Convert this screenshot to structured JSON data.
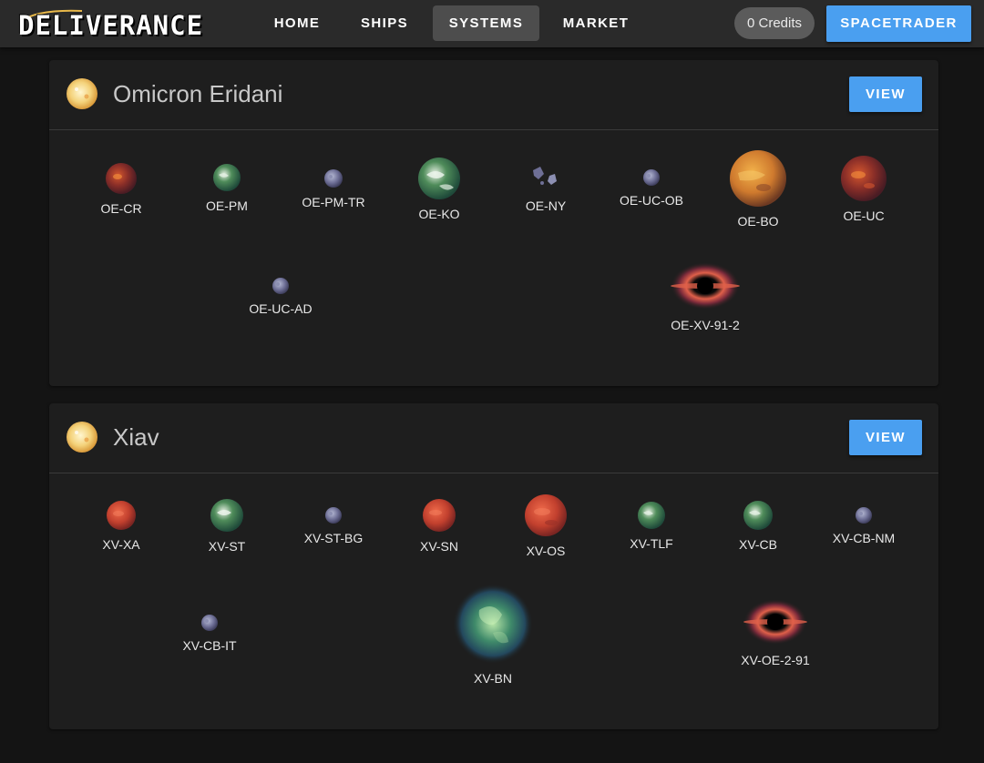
{
  "app": {
    "logo_text": "DELIVERANCE",
    "nav": [
      "HOME",
      "SHIPS",
      "SYSTEMS",
      "MARKET"
    ],
    "active_nav": "SYSTEMS",
    "credits": "0 Credits",
    "account_button": "SPACETRADER"
  },
  "colors": {
    "accent": "#4a9ff0",
    "card_bg": "#1e1e1e",
    "nav_bg": "#2a2a2a"
  },
  "systems": [
    {
      "name": "Omicron Eridani",
      "view_label": "VIEW",
      "icon": "star-icon",
      "bodies": [
        {
          "label": "OE-CR",
          "type": "rocky-red-planet"
        },
        {
          "label": "OE-PM",
          "type": "earthlike-planet"
        },
        {
          "label": "OE-PM-TR",
          "type": "moon"
        },
        {
          "label": "OE-KO",
          "type": "earthlike-planet"
        },
        {
          "label": "OE-NY",
          "type": "asteroid-field"
        },
        {
          "label": "OE-UC-OB",
          "type": "moon"
        },
        {
          "label": "OE-BO",
          "type": "gas-giant"
        },
        {
          "label": "OE-UC",
          "type": "rocky-red-planet"
        },
        {
          "label": "OE-UC-AD",
          "type": "moon"
        },
        {
          "label": "OE-XV-91-2",
          "type": "wormhole"
        }
      ]
    },
    {
      "name": "Xiav",
      "view_label": "VIEW",
      "icon": "star-icon",
      "bodies": [
        {
          "label": "XV-XA",
          "type": "red-planet"
        },
        {
          "label": "XV-ST",
          "type": "earthlike-planet"
        },
        {
          "label": "XV-ST-BG",
          "type": "moon"
        },
        {
          "label": "XV-SN",
          "type": "red-planet"
        },
        {
          "label": "XV-OS",
          "type": "red-planet"
        },
        {
          "label": "XV-TLF",
          "type": "earthlike-planet"
        },
        {
          "label": "XV-CB",
          "type": "earthlike-planet"
        },
        {
          "label": "XV-CB-NM",
          "type": "moon"
        },
        {
          "label": "XV-CB-IT",
          "type": "moon"
        },
        {
          "label": "XV-BN",
          "type": "nebula"
        },
        {
          "label": "XV-OE-2-91",
          "type": "wormhole"
        }
      ]
    }
  ]
}
